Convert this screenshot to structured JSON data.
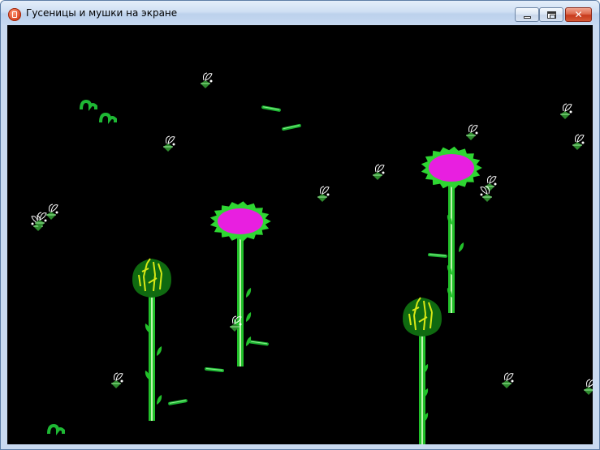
{
  "window": {
    "title": "Гусеницы и мушки на экране",
    "controls": {
      "minimize": "minimize",
      "maximize": "maximize",
      "close": "✕"
    }
  },
  "colors": {
    "background": "#000000",
    "stem_green": "#22c02a",
    "leaf_green": "#22c02a",
    "petal_green": "#2ed632",
    "flower_center": "#e81fe0",
    "bud_dark": "#0f6a10",
    "bud_veins": "#d8e816",
    "caterpillar": "#1eb834",
    "fly_wing": "#ffffff"
  },
  "scene": {
    "flowers": [
      {
        "type": "bloom",
        "name": "flower-bloom-1"
      },
      {
        "type": "bloom",
        "name": "flower-bloom-2"
      },
      {
        "type": "bud",
        "name": "flower-bud-1"
      },
      {
        "type": "bud",
        "name": "flower-bud-2"
      }
    ],
    "caterpillar_count": 9,
    "fly_count": 16
  }
}
